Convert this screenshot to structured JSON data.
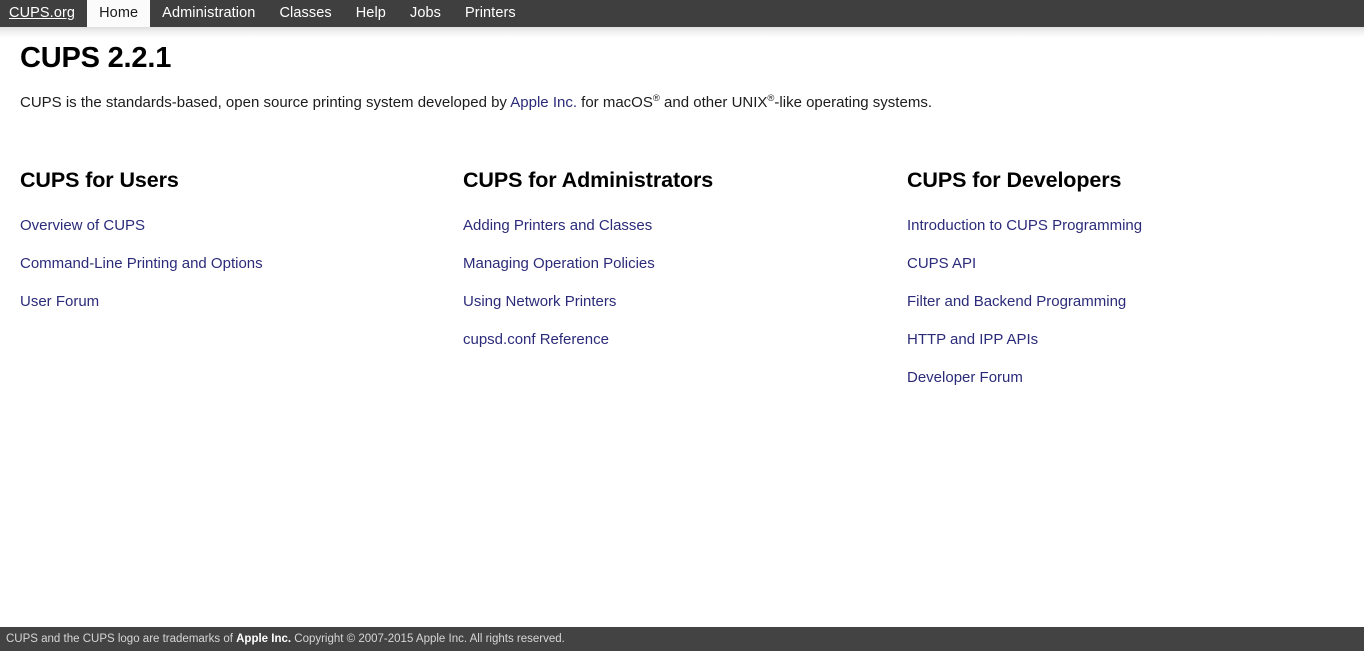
{
  "navbar": {
    "brand": "CUPS.org",
    "items": [
      {
        "label": "Home",
        "active": true
      },
      {
        "label": "Administration",
        "active": false
      },
      {
        "label": "Classes",
        "active": false
      },
      {
        "label": "Help",
        "active": false
      },
      {
        "label": "Jobs",
        "active": false
      },
      {
        "label": "Printers",
        "active": false
      }
    ]
  },
  "main": {
    "title": "CUPS 2.2.1",
    "intro": {
      "before_link": "CUPS is the standards-based, open source printing system developed by ",
      "link": "Apple Inc.",
      "after_link_1": " for macOS",
      "sup_1": "®",
      "after_link_2": " and other UNIX",
      "sup_2": "®",
      "after_link_3": "-like operating systems."
    },
    "columns": [
      {
        "heading": "CUPS for Users",
        "links": [
          "Overview of CUPS",
          "Command-Line Printing and Options",
          "User Forum"
        ]
      },
      {
        "heading": "CUPS for Administrators",
        "links": [
          "Adding Printers and Classes",
          "Managing Operation Policies",
          "Using Network Printers",
          "cupsd.conf Reference"
        ]
      },
      {
        "heading": "CUPS for Developers",
        "links": [
          "Introduction to CUPS Programming",
          "CUPS API",
          "Filter and Backend Programming",
          "HTTP and IPP APIs",
          "Developer Forum"
        ]
      }
    ]
  },
  "footer": {
    "text_before_bold": "CUPS and the CUPS logo are trademarks of ",
    "bold": "Apple Inc.",
    "text_after_bold": " Copyright © 2007-2015 Apple Inc. All rights reserved."
  },
  "colors": {
    "nav_background": "#3f3f3f",
    "nav_active_background": "#fbfbfb",
    "link": "#2b2b7a",
    "footer_background": "#434343",
    "footer_text": "#d6d6d6",
    "page_background": "#ffffff"
  }
}
